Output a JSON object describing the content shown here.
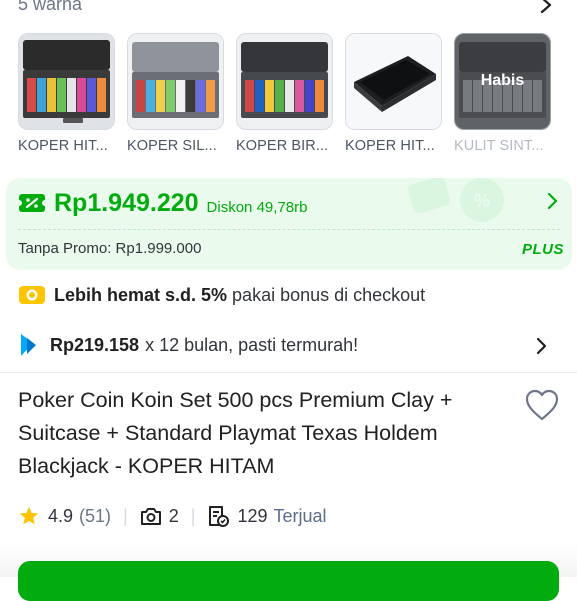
{
  "variants": {
    "count_text": "5 warna",
    "items": [
      {
        "label": "KOPER HIT...",
        "available": true
      },
      {
        "label": "KOPER SIL...",
        "available": true
      },
      {
        "label": "KOPER BIR...",
        "available": true
      },
      {
        "label": "KOPER HIT...",
        "available": true
      },
      {
        "label": "KULIT SINT...",
        "available": false,
        "badge": "Habis"
      }
    ]
  },
  "price": {
    "value": "Rp1.949.220",
    "discount": "Diskon 49,78rb",
    "original": "Tanpa Promo: Rp1.999.000",
    "plus_label": "PLUS",
    "accent": "#03ac0e"
  },
  "bonus": {
    "bold": "Lebih hemat s.d. 5%",
    "rest": "pakai bonus di checkout"
  },
  "installment": {
    "amount": "Rp219.158",
    "rest": "x 12 bulan, pasti termurah!"
  },
  "product": {
    "title": "Poker Coin Koin Set 500 pcs Premium Clay + Suitcase + Standard Playmat Texas Holdem Blackjack - KOPER HITAM"
  },
  "stats": {
    "rating": "4.9",
    "rating_count": "(51)",
    "photos": "2",
    "sold": "129",
    "sold_label": "Terjual"
  }
}
